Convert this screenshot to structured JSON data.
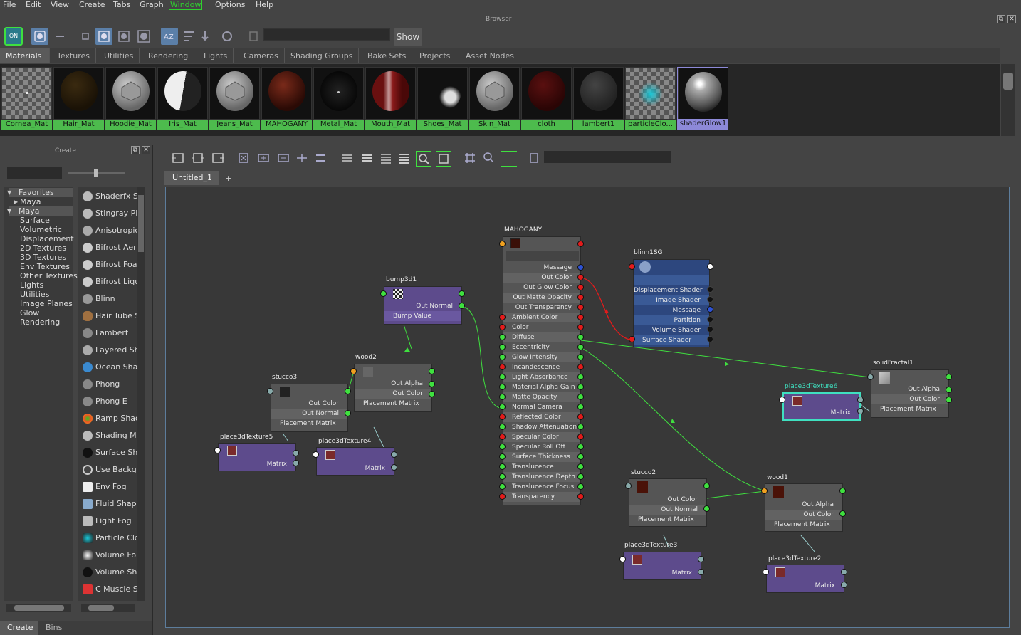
{
  "menu": [
    "File",
    "Edit",
    "View",
    "Create",
    "Tabs",
    "Graph",
    "Window",
    "Options",
    "Help"
  ],
  "browser_title": "Browser",
  "show_button": "Show",
  "tabs": [
    "Materials",
    "Textures",
    "Utilities",
    "Rendering",
    "Lights",
    "Cameras",
    "Shading Groups",
    "Bake Sets",
    "Projects",
    "Asset Nodes"
  ],
  "swatches": [
    "Cornea_Mat",
    "Hair_Mat",
    "Hoodie_Mat",
    "Iris_Mat",
    "Jeans_Mat",
    "MAHOGANY",
    "Metal_Mat",
    "Mouth_Mat",
    "Shoes_Mat",
    "Skin_Mat",
    "cloth",
    "lambert1",
    "particleClo...",
    "shaderGlow1"
  ],
  "create_panel": {
    "title": "Create",
    "categories": [
      "Favorites",
      "Maya",
      "Maya",
      "Surface",
      "Volumetric",
      "Displacement",
      "2D Textures",
      "3D Textures",
      "Env Textures",
      "Other Textures",
      "Lights",
      "Utilities",
      "Image Planes",
      "Glow",
      "Rendering"
    ],
    "nodes": [
      "Shaderfx Sh",
      "Stingray PB",
      "Anisotropic",
      "Bifrost Aero",
      "Bifrost Foa",
      "Bifrost Liqu",
      "Blinn",
      "Hair Tube S",
      "Lambert",
      "Layered Sha",
      "Ocean Shad",
      "Phong",
      "Phong E",
      "Ramp Shad",
      "Shading M",
      "Surface Sha",
      "Use Backgr",
      "Env Fog",
      "Fluid Shape",
      "Light Fog",
      "Particle Clo",
      "Volume Fo",
      "Volume Sha",
      "C Muscle Sh"
    ],
    "bottom_tabs": [
      "Create",
      "Bins"
    ]
  },
  "editor": {
    "tab": "Untitled_1",
    "add_tab": "+",
    "nodes": {
      "mahogany": {
        "title": "MAHOGANY",
        "ports": [
          "Message",
          "Out Color",
          "Out Glow Color",
          "Out Matte Opacity",
          "Out Transparency",
          "Ambient Color",
          "Color",
          "Diffuse",
          "Eccentricity",
          "Glow Intensity",
          "Incandescence",
          "Light Absorbance",
          "Material Alpha Gain",
          "Matte Opacity",
          "Normal Camera",
          "Reflected Color",
          "Shadow Attenuation",
          "Specular Color",
          "Specular Roll Off",
          "Surface Thickness",
          "Translucence",
          "Translucence Depth",
          "Translucence Focus",
          "Transparency"
        ]
      },
      "blinn1sg": {
        "title": "blinn1SG",
        "ports": [
          "Displacement Shader",
          "Image Shader",
          "Message",
          "Partition",
          "Volume Shader",
          "Surface Shader"
        ]
      },
      "bump3d1": {
        "title": "bump3d1",
        "ports": [
          "Out Normal",
          "Bump Value"
        ]
      },
      "wood2": {
        "title": "wood2",
        "ports": [
          "Out Alpha",
          "Out Color",
          "Placement Matrix"
        ]
      },
      "stucco3": {
        "title": "stucco3",
        "ports": [
          "Out Color",
          "Out Normal",
          "Placement Matrix"
        ]
      },
      "place3dTexture5": {
        "title": "place3dTexture5",
        "ports": [
          "Matrix"
        ]
      },
      "place3dTexture4": {
        "title": "place3dTexture4",
        "ports": [
          "Matrix"
        ]
      },
      "solidFractal1": {
        "title": "solidFractal1",
        "ports": [
          "Out Alpha",
          "Out Color",
          "Placement Matrix"
        ]
      },
      "place3dTexture6": {
        "title": "place3dTexture6",
        "ports": [
          "Matrix"
        ]
      },
      "stucco2": {
        "title": "stucco2",
        "ports": [
          "Out Color",
          "Out Normal",
          "Placement Matrix"
        ]
      },
      "wood1": {
        "title": "wood1",
        "ports": [
          "Out Alpha",
          "Out Color",
          "Placement Matrix"
        ]
      },
      "place3dTexture3": {
        "title": "place3dTexture3",
        "ports": [
          "Matrix"
        ]
      },
      "place3dTexture2": {
        "title": "place3dTexture2",
        "ports": [
          "Matrix"
        ]
      }
    }
  },
  "colors": {
    "swatch_label": "#4dbb4d",
    "selected_swatch": "#8d89d8",
    "texture_node": "#5d4b8c",
    "sg_node": "#2d477e",
    "connection": "#3fe03f",
    "highlight_connection": "#e31b1b"
  }
}
